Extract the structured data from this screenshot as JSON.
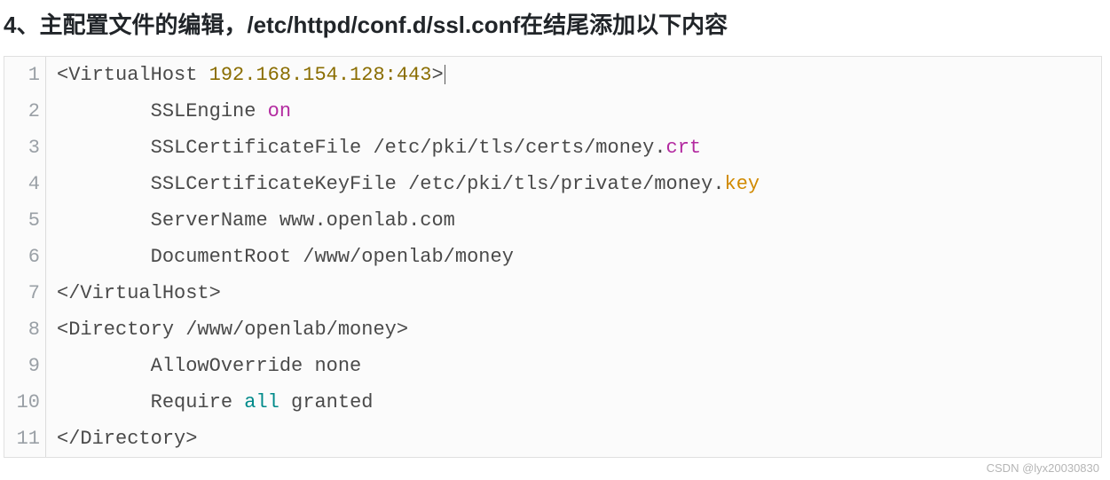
{
  "heading": "4、主配置文件的编辑，/etc/httpd/conf.d/ssl.conf在结尾添加以下内容",
  "code": {
    "line1": {
      "open": "<VirtualHost ",
      "addr": "192.168.154.128:443",
      "close": ">"
    },
    "line2": {
      "indent": "        ",
      "directive": "SSLEngine ",
      "value": "on"
    },
    "line3": {
      "indent": "        ",
      "text": "SSLCertificateFile /etc/pki/tls/certs/money.",
      "ext": "crt"
    },
    "line4": {
      "indent": "        ",
      "text": "SSLCertificateKeyFile /etc/pki/tls/private/money.",
      "ext": "key"
    },
    "line5": {
      "indent": "        ",
      "text": "ServerName www.openlab.com"
    },
    "line6": {
      "indent": "        ",
      "text": "DocumentRoot /www/openlab/money"
    },
    "line7": {
      "text": "</VirtualHost>"
    },
    "line8": {
      "text": "<Directory /www/openlab/money>"
    },
    "line9": {
      "indent": "        ",
      "text": "AllowOverride none"
    },
    "line10": {
      "indent": "        ",
      "pre": "Require ",
      "kw": "all",
      "post": " granted"
    },
    "line11": {
      "text": "</Directory>"
    }
  },
  "linenos": {
    "n1": "1",
    "n2": "2",
    "n3": "3",
    "n4": "4",
    "n5": "5",
    "n6": "6",
    "n7": "7",
    "n8": "8",
    "n9": "9",
    "n10": "10",
    "n11": "11"
  },
  "watermark": "CSDN @lyx20030830"
}
